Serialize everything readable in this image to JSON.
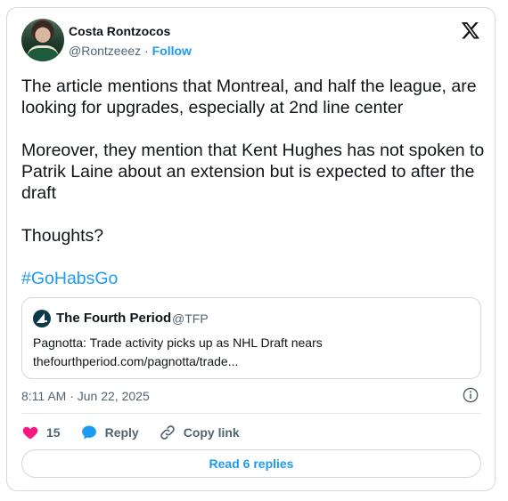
{
  "author": {
    "display_name": "Costa Rontzocos",
    "handle": "@Rontzeeez",
    "separator": "·",
    "follow_label": "Follow"
  },
  "tweet": {
    "paragraph1": "The article mentions that Montreal, and half the league, are looking for upgrades, especially at 2nd line center",
    "paragraph2": "Moreover, they mention that Kent Hughes has not spoken to Patrik Laine about an extension but is expected to after the draft",
    "paragraph3": "Thoughts?",
    "hashtag": "#GoHabsGo"
  },
  "quote": {
    "name": "The Fourth Period",
    "handle": "@TFP",
    "title": "Pagnotta: Trade activity picks up as NHL Draft nears",
    "url": "thefourthperiod.com/pagnotta/trade..."
  },
  "timestamp": "8:11 AM · Jun 22, 2025",
  "actions": {
    "likes": "15",
    "reply_label": "Reply",
    "copy_link_label": "Copy link"
  },
  "replies_button": "Read 6 replies",
  "colors": {
    "accent": "#1d9bf0",
    "like": "#f91880",
    "text": "#0f1419",
    "muted": "#536471",
    "border": "#cfd9de"
  }
}
